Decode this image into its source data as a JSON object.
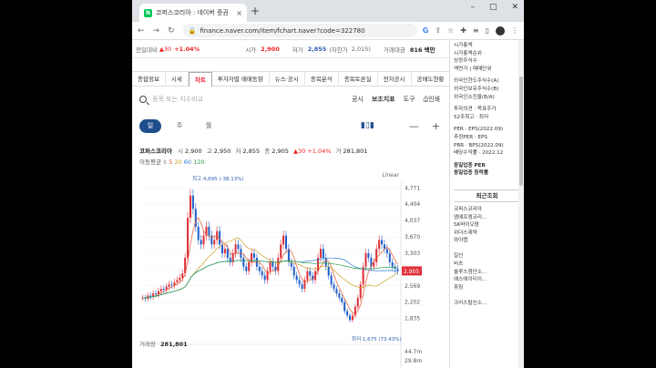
{
  "browser": {
    "tab_title": "코퍼스코리아 : 네이버 증권",
    "tab_close": "×",
    "new_tab": "+",
    "url": "finance.naver.com/item/fchart.naver?code=322780",
    "win_min": "–",
    "win_max": "□",
    "win_close": "✕"
  },
  "quote_bar": {
    "prev_label": "전일대비",
    "prev_change": "▲30",
    "prev_pct": "+1.04%",
    "open_label": "시가",
    "open_value": "2,900",
    "low_label": "저가",
    "low_value": "2,855",
    "lowlimit_label": "(하한가",
    "lowlimit_value": "2,015)",
    "amount_label": "거래대금",
    "amount_value": "816 백만"
  },
  "nav_tabs": [
    "종합정보",
    "시세",
    "차트",
    "투자자별 매매동향",
    "뉴스·공시",
    "종목분석",
    "종목토론실",
    "전자공시",
    "공매도현황"
  ],
  "active_tab": 2,
  "search": {
    "placeholder": "종목 또는 지수비교",
    "items": [
      "공시",
      "보조지표",
      "도구",
      "인쇄"
    ]
  },
  "periods": [
    "일",
    "주",
    "월"
  ],
  "chart_info": {
    "name": "코퍼스코리아",
    "open_lbl": "시",
    "open": "2,900",
    "high_lbl": "고",
    "high": "2,950",
    "low_lbl": "저",
    "low": "2,855",
    "close_lbl": "종",
    "close": "2,905",
    "change": "▲30 +1.04%",
    "vol_lbl": "거",
    "vol": "281,801",
    "ma_label": "이동평균",
    "ma_values": [
      "5",
      "20",
      "60",
      "120"
    ],
    "scale": "Linear"
  },
  "chart_data": {
    "type": "candlestick",
    "ylim": [
      1500,
      4900
    ],
    "yticks": [
      4771,
      4404,
      4037,
      3670,
      3303,
      2936,
      2569,
      2202,
      1835
    ],
    "ytick_labels": [
      "4,771",
      "4,404",
      "4,037",
      "3,670",
      "3,303",
      "2,905",
      "2,569",
      "2,202",
      "1,835"
    ],
    "current_price": "2,905",
    "high_annotation": "최고 4,695 (-38.13%)",
    "low_annotation": "최저 1,675 (73.43%)",
    "closes": [
      2300,
      2280,
      2350,
      2320,
      2400,
      2380,
      2450,
      2500,
      2480,
      2550,
      2600,
      2580,
      2650,
      2700,
      2750,
      2850,
      3200,
      4100,
      4600,
      4300,
      3900,
      3600,
      3500,
      3700,
      3900,
      3700,
      3500,
      3600,
      3800,
      3500,
      3300,
      3400,
      3200,
      3100,
      3300,
      3500,
      3400,
      3200,
      3000,
      2900,
      3100,
      3300,
      3200,
      3000,
      2900,
      2800,
      2700,
      2900,
      3100,
      3000,
      2900,
      3200,
      3500,
      3700,
      3400,
      3100,
      3000,
      2800,
      2700,
      2600,
      2500,
      2700,
      2900,
      2800,
      2700,
      2900,
      3200,
      3400,
      3200,
      3000,
      2800,
      2600,
      2500,
      2400,
      2300,
      2200,
      2000,
      1900,
      1800,
      1900,
      2100,
      2300,
      2600,
      3000,
      3300,
      3200,
      3000,
      3100,
      3400,
      3600,
      3500,
      3400,
      3300,
      3100,
      3000,
      2950,
      2905
    ],
    "volume_label": "거래량",
    "volume": "281,801",
    "volume_ticks": [
      "44.7m",
      "29.8m"
    ]
  },
  "right_panel": {
    "lines1": [
      "시가총액",
      "시가총액순위 ·",
      "상장주식수",
      "액면가 | 매매단위"
    ],
    "lines2": [
      "외국인한도주식수(A)",
      "외국인보유주식수(B)",
      "외국인소진율(B/A)"
    ],
    "lines3": [
      "투자의견 · 목표주가",
      "52주최고 · 최저"
    ],
    "lines4": [
      "PER · EPS(2022.09)",
      "추정PER · EPS",
      "PBR · BPS(2022.09)",
      "배당수익률 · 2022.12"
    ],
    "lines5": [
      "동일업종 PER",
      "동일업종 등락률"
    ],
    "recent_title": "최근조회",
    "recent": [
      "코퍼스코리아",
      "엠에프엠코리...",
      "SK바이오팜",
      "위더스제약",
      "와이랩",
      "",
      "일신",
      "비츠",
      "솔루스첨단소...",
      "에스에이티이...",
      "휴림",
      "",
      "크리스탈신소..."
    ]
  }
}
